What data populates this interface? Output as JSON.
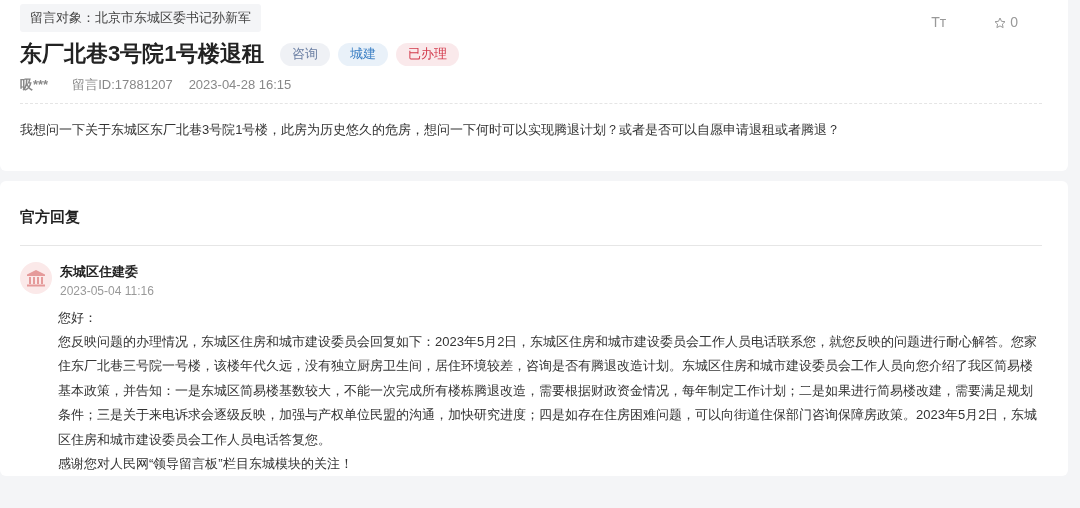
{
  "message": {
    "target": "留言对象：北京市东城区委书记孙新军",
    "font_size_toggle": "Tт",
    "favorite": {
      "count": "0"
    },
    "title": "东厂北巷3号院1号楼退租",
    "tags": [
      {
        "label": "咨询",
        "color": "#6b7fa3"
      },
      {
        "label": "城建",
        "color": "#3b7fc4"
      },
      {
        "label": "已办理",
        "color": "#d23a4c"
      }
    ],
    "author": "吸***",
    "message_id": "留言ID:17881207",
    "time": "2023-04-28 16:15",
    "body": "我想问一下关于东城区东厂北巷3号院1号楼，此房为历史悠久的危房，想问一下何时可以实现腾退计划？或者是否可以自愿申请退租或者腾退？"
  },
  "reply": {
    "heading": "官方回复",
    "department": "东城区住建委",
    "time": "2023-05-04 11:16",
    "paragraphs": [
      "您好：",
      "您反映问题的办理情况，东城区住房和城市建设委员会回复如下：2023年5月2日，东城区住房和城市建设委员会工作人员电话联系您，就您反映的问题进行耐心解答。您家住东厂北巷三号院一号楼，该楼年代久远，没有独立厨房卫生间，居住环境较差，咨询是否有腾退改造计划。东城区住房和城市建设委员会工作人员向您介绍了我区简易楼基本政策，并告知：一是东城区简易楼基数较大，不能一次完成所有楼栋腾退改造，需要根据财政资金情况，每年制定工作计划；二是如果进行简易楼改建，需要满足规划条件；三是关于来电诉求会逐级反映，加强与产权单位民盟的沟通，加快研究进度；四是如存在住房困难问题，可以向街道住保部门咨询保障房政策。2023年5月2日，东城区住房和城市建设委员会工作人员电话答复您。",
      "感谢您对人民网“领导留言板”栏目东城模块的关注！"
    ]
  }
}
